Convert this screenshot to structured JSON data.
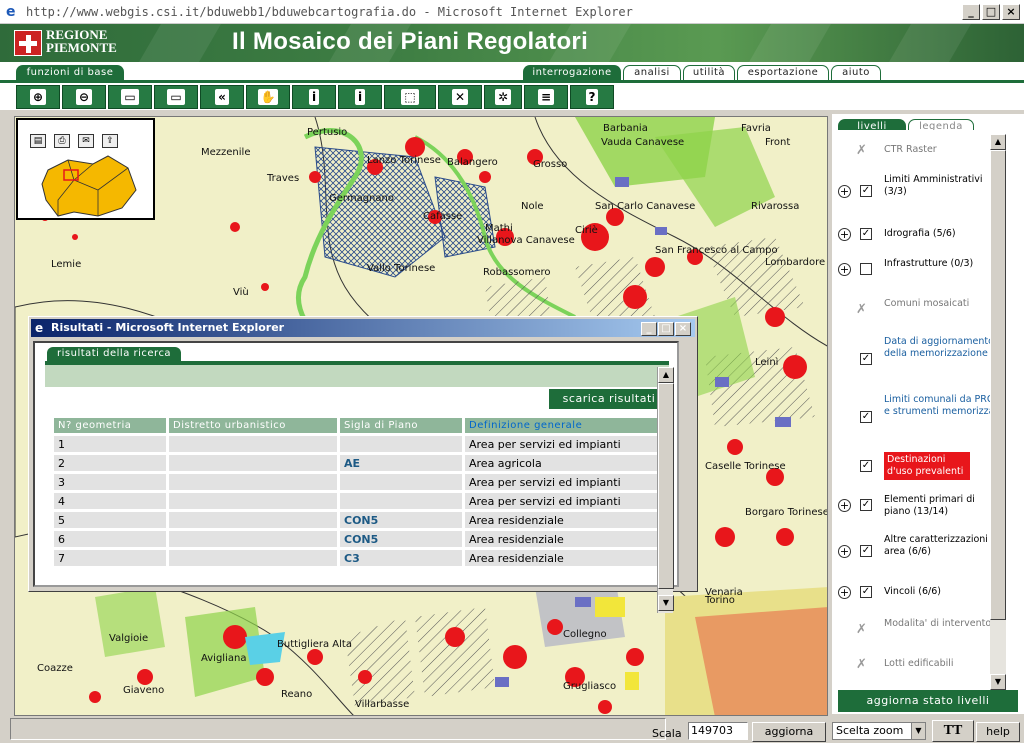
{
  "window": {
    "title": "http://www.webgis.csi.it/bduwebb1/bduwebcartografia.do - Microsoft Internet Explorer",
    "buttons": [
      "_",
      "□",
      "×"
    ]
  },
  "banner": {
    "region_line1": "REGIONE",
    "region_line2": "PIEMONTE",
    "app_title": "Il Mosaico dei Piani Regolatori"
  },
  "tabs": {
    "left": "funzioni di base",
    "right": [
      {
        "label": "interrogazione",
        "active": true
      },
      {
        "label": "analisi",
        "active": false
      },
      {
        "label": "utilità",
        "active": false
      },
      {
        "label": "esportazione",
        "active": false
      },
      {
        "label": "aiuto",
        "active": false
      }
    ]
  },
  "toolbar": {
    "tools": [
      {
        "icon": "zoom-in-icon",
        "glyph": "⊕"
      },
      {
        "icon": "zoom-out-icon",
        "glyph": "⊖"
      },
      {
        "icon": "zoom-window-icon",
        "glyph": "▭"
      },
      {
        "icon": "zoom-extent-icon",
        "glyph": "▭"
      },
      {
        "icon": "zoom-previous-icon",
        "glyph": "«"
      },
      {
        "icon": "pan-hand-icon",
        "glyph": "✋"
      },
      {
        "icon": "info-point-icon",
        "glyph": "i"
      },
      {
        "icon": "info-list-icon",
        "glyph": "i"
      },
      {
        "icon": "select-rect-icon",
        "glyph": "⬚"
      },
      {
        "icon": "clear-selection-icon",
        "glyph": "✕"
      },
      {
        "icon": "center-target-icon",
        "glyph": "✲"
      },
      {
        "icon": "query-results-icon",
        "glyph": "≡"
      },
      {
        "icon": "query-help-icon",
        "glyph": "?"
      }
    ]
  },
  "map": {
    "places": [
      "Mezzenile",
      "Pertusio",
      "Lanzo Torinese",
      "Balangero",
      "Grosso",
      "Barbania",
      "Vauda Canavese",
      "Favria",
      "Front",
      "Traves",
      "Germagnano",
      "Cafasse",
      "Nole",
      "San Carlo Canavese",
      "Rivarossa",
      "Ciriè",
      "Mathi",
      "Lombardore",
      "Villanova Canavese",
      "San Francesco al Campo",
      "Lemie",
      "Vallo Torinese",
      "Robassomero",
      "Viù",
      "Leinì",
      "Caselle Torinese",
      "Venaria",
      "Borgaro Torinese",
      "Valgioie",
      "Avigliana",
      "Buttigliera Alta",
      "Coazze",
      "Giaveno",
      "Reano",
      "Villarbasse",
      "Collegno",
      "Grugliasco",
      "Torino"
    ]
  },
  "overview": {
    "icons": [
      "save-icon",
      "print-icon",
      "mail-icon",
      "export-icon"
    ]
  },
  "dialog": {
    "title": "Risultati - Microsoft Internet Explorer",
    "tab": "risultati della ricerca",
    "download_button": "scarica risultati",
    "columns": [
      "N? geometria",
      "Distretto urbanistico",
      "Sigla di Piano",
      "Definizione generale"
    ],
    "rows": [
      {
        "n": "1",
        "distretto": "",
        "sigla": "",
        "definizione": "Area per servizi ed impianti"
      },
      {
        "n": "2",
        "distretto": "",
        "sigla": "AE",
        "definizione": "Area agricola"
      },
      {
        "n": "3",
        "distretto": "",
        "sigla": "",
        "definizione": "Area per servizi ed impianti"
      },
      {
        "n": "4",
        "distretto": "",
        "sigla": "",
        "definizione": "Area per servizi ed impianti"
      },
      {
        "n": "5",
        "distretto": "",
        "sigla": "CON5",
        "definizione": "Area residenziale"
      },
      {
        "n": "6",
        "distretto": "",
        "sigla": "CON5",
        "definizione": "Area residenziale"
      },
      {
        "n": "7",
        "distretto": "",
        "sigla": "C3",
        "definizione": "Area residenziale"
      }
    ]
  },
  "panel": {
    "tab_active": "livelli",
    "tab_inactive": "legenda",
    "layers": [
      {
        "label": "CTR Raster",
        "expand": false,
        "checkbox": "none",
        "style": "grey"
      },
      {
        "label": "Limiti Amministrativi (3/3)",
        "expand": true,
        "checkbox": "checked",
        "style": "normal"
      },
      {
        "label": "Idrografia (5/6)",
        "expand": true,
        "checkbox": "checked",
        "style": "normal"
      },
      {
        "label": "Infrastrutture (0/3)",
        "expand": true,
        "checkbox": "unchecked",
        "style": "normal"
      },
      {
        "label": "Comuni mosaicati",
        "expand": false,
        "checkbox": "none",
        "style": "grey"
      },
      {
        "label": "Data di aggiornamento della memorizzazione",
        "expand": false,
        "checkbox": "checked",
        "style": "blue"
      },
      {
        "label": "Limiti comunali da PRG e strumenti memorizzati",
        "expand": false,
        "checkbox": "checked",
        "style": "blue"
      },
      {
        "label": "Destinazioni d'uso prevalenti",
        "expand": false,
        "checkbox": "checked",
        "style": "red"
      },
      {
        "label": "Elementi primari di piano (13/14)",
        "expand": true,
        "checkbox": "checked",
        "style": "normal"
      },
      {
        "label": "Altre caratterizzazioni di area (6/6)",
        "expand": true,
        "checkbox": "checked",
        "style": "normal"
      },
      {
        "label": "Vincoli (6/6)",
        "expand": true,
        "checkbox": "checked",
        "style": "normal"
      },
      {
        "label": "Modalita' di intervento",
        "expand": false,
        "checkbox": "none",
        "style": "grey"
      },
      {
        "label": "Lotti edificabili",
        "expand": false,
        "checkbox": "none",
        "style": "grey"
      }
    ],
    "update_button": "aggiorna stato livelli"
  },
  "bottom": {
    "scale_label": "Scala",
    "scale_value": "149703",
    "update_button": "aggiorna",
    "zoom_select": "Scelta zoom",
    "help_button": "help"
  },
  "colors": {
    "accent": "#1e6d3a",
    "map_bg": "#f1f0c8",
    "residential": "#e8161b",
    "green_area": "#8fd34a",
    "services": "#6a6fc4"
  }
}
